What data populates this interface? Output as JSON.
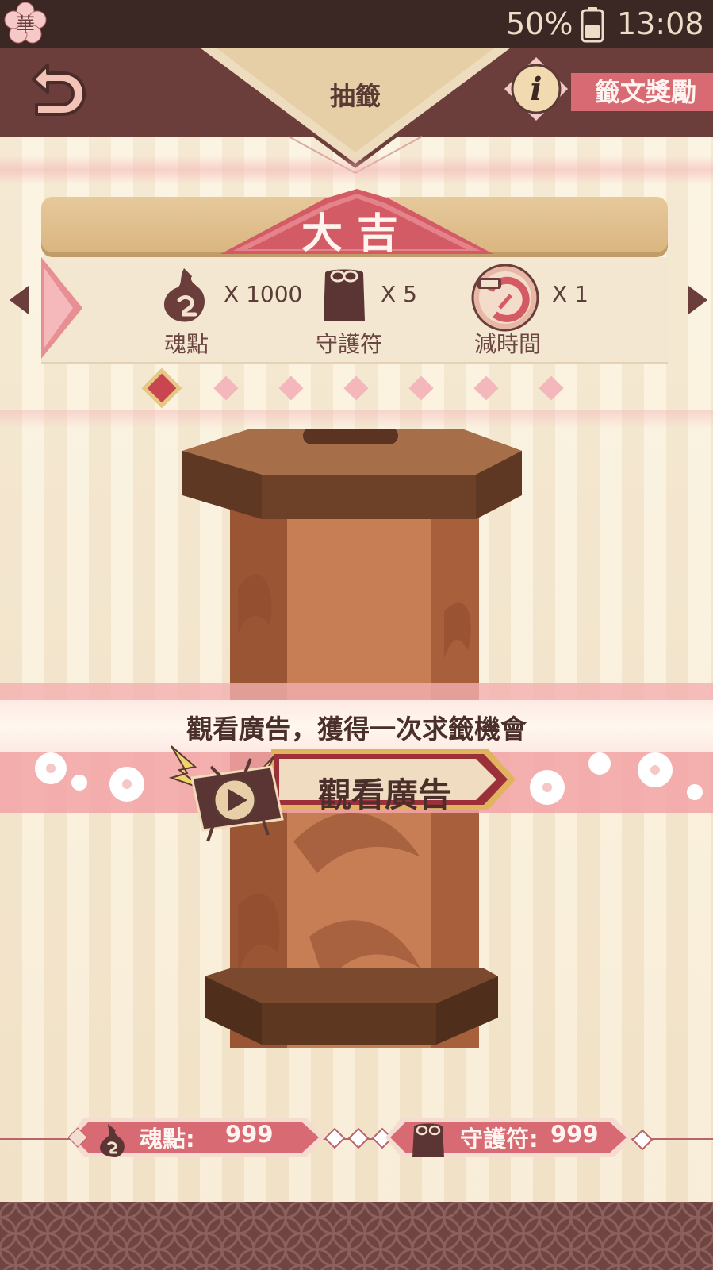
{
  "status_bar": {
    "battery": "50%",
    "time": "13:08",
    "logo_char": "華"
  },
  "header": {
    "title": "抽籤",
    "rewards_label": "籤文獎勵",
    "info_icon": "i"
  },
  "fortune": {
    "level": "大吉",
    "rewards": [
      {
        "name": "魂點",
        "qty": "X  1000",
        "icon": "soul-point-icon"
      },
      {
        "name": "守護符",
        "qty": "X  5",
        "icon": "amulet-icon"
      },
      {
        "name": "減時間",
        "qty": "X  1",
        "icon": "time-reduce-icon"
      }
    ],
    "page_count": 7,
    "active_page": 0
  },
  "ad": {
    "prompt": "觀看廣告，獲得一次求籤機會",
    "button_label": "觀看廣告"
  },
  "currency": {
    "soul": {
      "label": "魂點:",
      "value": "999"
    },
    "amulet": {
      "label": "守護符:",
      "value": "999"
    }
  },
  "colors": {
    "accent": "#d86a73",
    "dark": "#6b3d3b",
    "parchment": "#f6ecd7"
  }
}
